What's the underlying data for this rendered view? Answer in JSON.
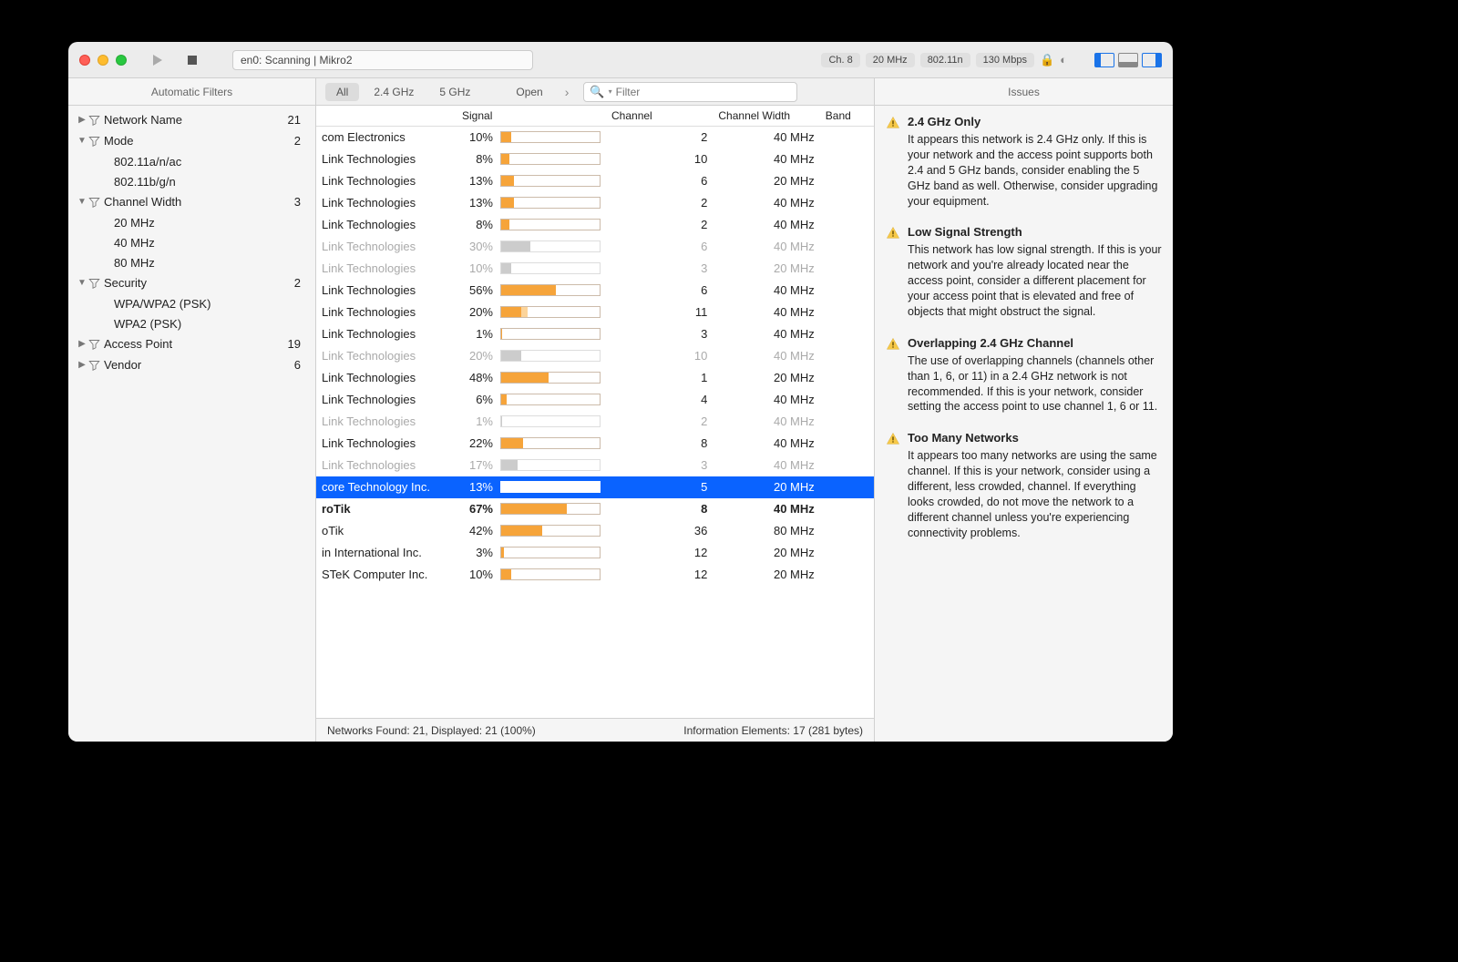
{
  "window": {
    "status": "en0: Scanning  |  Mikro2",
    "chips": {
      "channel": "Ch. 8",
      "width": "20 MHz",
      "mode": "802.11n",
      "rate": "130 Mbps"
    }
  },
  "sidebar": {
    "title": "Automatic Filters",
    "items": [
      {
        "label": "Network Name",
        "count": "21",
        "disc": "▶",
        "children": []
      },
      {
        "label": "Mode",
        "count": "2",
        "disc": "▼",
        "children": [
          "802.11a/n/ac",
          "802.11b/g/n"
        ]
      },
      {
        "label": "Channel Width",
        "count": "3",
        "disc": "▼",
        "children": [
          "20 MHz",
          "40 MHz",
          "80 MHz"
        ]
      },
      {
        "label": "Security",
        "count": "2",
        "disc": "▼",
        "children": [
          "WPA/WPA2 (PSK)",
          "WPA2 (PSK)"
        ]
      },
      {
        "label": "Access Point",
        "count": "19",
        "disc": "▶",
        "children": []
      },
      {
        "label": "Vendor",
        "count": "6",
        "disc": "▶",
        "children": []
      }
    ]
  },
  "filterbar": {
    "all": "All",
    "b24": "2.4 GHz",
    "b5": "5 GHz",
    "open": "Open",
    "search_placeholder": "Filter"
  },
  "columns": {
    "signal": "Signal",
    "channel": "Channel",
    "width": "Channel Width",
    "band": "Band"
  },
  "networks": [
    {
      "vendor": "com Electronics",
      "pct": 10,
      "chan": "2",
      "cw": "40 MHz",
      "dim": false
    },
    {
      "vendor": "Link Technologies",
      "pct": 8,
      "chan": "10",
      "cw": "40 MHz",
      "dim": false
    },
    {
      "vendor": "Link Technologies",
      "pct": 13,
      "chan": "6",
      "cw": "20 MHz",
      "dim": false
    },
    {
      "vendor": "Link Technologies",
      "pct": 13,
      "chan": "2",
      "cw": "40 MHz",
      "dim": false
    },
    {
      "vendor": "Link Technologies",
      "pct": 8,
      "chan": "2",
      "cw": "40 MHz",
      "dim": false
    },
    {
      "vendor": "Link Technologies",
      "pct": 30,
      "chan": "6",
      "cw": "40 MHz",
      "dim": true
    },
    {
      "vendor": "Link Technologies",
      "pct": 10,
      "chan": "3",
      "cw": "20 MHz",
      "dim": true
    },
    {
      "vendor": "Link Technologies",
      "pct": 56,
      "chan": "6",
      "cw": "40 MHz",
      "dim": false
    },
    {
      "vendor": "Link Technologies",
      "pct": 20,
      "pct2": 27,
      "chan": "11",
      "cw": "40 MHz",
      "dim": false
    },
    {
      "vendor": "Link Technologies",
      "pct": 1,
      "chan": "3",
      "cw": "40 MHz",
      "dim": false
    },
    {
      "vendor": "Link Technologies",
      "pct": 20,
      "chan": "10",
      "cw": "40 MHz",
      "dim": true
    },
    {
      "vendor": "Link Technologies",
      "pct": 48,
      "chan": "1",
      "cw": "20 MHz",
      "dim": false
    },
    {
      "vendor": "Link Technologies",
      "pct": 6,
      "chan": "4",
      "cw": "40 MHz",
      "dim": false
    },
    {
      "vendor": "Link Technologies",
      "pct": 1,
      "chan": "2",
      "cw": "40 MHz",
      "dim": true
    },
    {
      "vendor": "Link Technologies",
      "pct": 22,
      "chan": "8",
      "cw": "40 MHz",
      "dim": false
    },
    {
      "vendor": "Link Technologies",
      "pct": 17,
      "chan": "3",
      "cw": "40 MHz",
      "dim": true
    },
    {
      "vendor": "core Technology Inc.",
      "pct": 13,
      "chan": "5",
      "cw": "20 MHz",
      "sel": true
    },
    {
      "vendor": "roTik",
      "pct": 67,
      "chan": "8",
      "cw": "40 MHz",
      "bold": true
    },
    {
      "vendor": "oTik",
      "pct": 42,
      "chan": "36",
      "cw": "80 MHz",
      "dim": false
    },
    {
      "vendor": "in International Inc.",
      "pct": 3,
      "chan": "12",
      "cw": "20 MHz",
      "dim": false
    },
    {
      "vendor": "STeK Computer Inc.",
      "pct": 10,
      "chan": "12",
      "cw": "20 MHz",
      "dim": false
    }
  ],
  "statusbar": {
    "left": "Networks Found: 21, Displayed: 21 (100%)",
    "right": "Information Elements: 17 (281 bytes)"
  },
  "issues": {
    "title": "Issues",
    "items": [
      {
        "title": "2.4 GHz Only",
        "body": "It appears this network is 2.4 GHz only. If this is your network and the access point supports both 2.4 and 5 GHz bands, consider enabling the 5 GHz band as well. Otherwise, consider upgrading your equipment."
      },
      {
        "title": "Low Signal Strength",
        "body": "This network has low signal strength. If this is your network and you're already located near the access point, consider a different placement for your access point that is elevated and free of objects that might obstruct the signal."
      },
      {
        "title": "Overlapping 2.4 GHz Channel",
        "body": "The use of overlapping channels (channels other than 1, 6, or 11) in a 2.4 GHz network is not recommended. If this is your network, consider setting the access point to use channel 1, 6 or 11."
      },
      {
        "title": "Too Many Networks",
        "body": "It appears too many networks are using the same channel. If this is your network, consider using a different, less crowded, channel. If everything looks crowded, do not move the network to a different channel unless you're experiencing connectivity problems."
      }
    ]
  }
}
